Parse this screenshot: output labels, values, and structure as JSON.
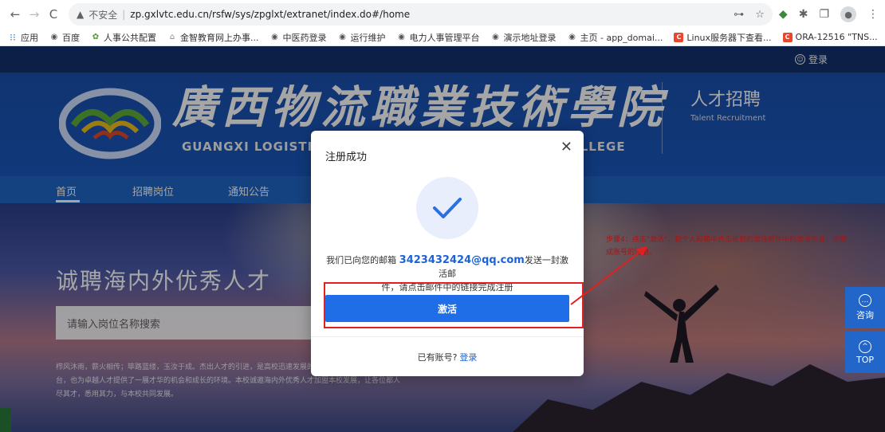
{
  "browser": {
    "insecure_label": "不安全",
    "url": "zp.gxlvtc.edu.cn/rsfw/sys/zpglxt/extranet/index.do#/home",
    "bookmarks": [
      {
        "icon": "apps-icon",
        "label": "应用"
      },
      {
        "icon": "globe-icon",
        "label": "百度"
      },
      {
        "icon": "green-icon",
        "label": "人事公共配置"
      },
      {
        "icon": "house-icon",
        "label": "金智教育网上办事..."
      },
      {
        "icon": "globe-icon",
        "label": "中医药登录"
      },
      {
        "icon": "globe-icon",
        "label": "运行维护"
      },
      {
        "icon": "globe-icon",
        "label": "电力人事管理平台"
      },
      {
        "icon": "globe-icon",
        "label": "演示地址登录"
      },
      {
        "icon": "globe-icon",
        "label": "主页 - app_domai..."
      },
      {
        "icon": "red-c-icon",
        "label": "Linux服务器下查看..."
      },
      {
        "icon": "red-c-icon",
        "label": "ORA-12516 \"TNS..."
      }
    ],
    "bookmarks_more": "»"
  },
  "site": {
    "login_top": "登录",
    "logo_cn": "廣西物流職業技術學院",
    "logo_en": "GUANGXI LOGISTICS VOCATIONAL AND TECHNICAL COLLEGE",
    "talent_cn": "人才招聘",
    "talent_en": "Talent Recruitment",
    "nav": [
      {
        "label": "首页"
      },
      {
        "label": "招聘岗位"
      },
      {
        "label": "通知公告"
      }
    ],
    "banner_title": "诚聘海内外优秀人才",
    "search_placeholder": "请输入岗位名称搜索",
    "intro_lines": [
      "栉风沐雨，薪火相传；筚路蓝缕，玉汝于成。杰出人才的引进，是高校迅速发展的不竭动力，我校为优秀人才提供了广阔的平",
      "台，也为卓越人才提供了一展才华的机会和成长的环境。本校诚邀海内外优秀人才加盟本校发展，让各位都人",
      "尽其才，悉用其力，与本校共同发展。"
    ],
    "red_note": "步骤4：点击\"激活\"，到个人邮箱中点击收到的激活邮件中的激活地址，即完成账号的注册。",
    "side_consult": "咨询",
    "side_top": "TOP"
  },
  "modal": {
    "title": "注册成功",
    "msg_prefix": "我们已向您的邮箱",
    "email": "3423432424@qq.com",
    "msg_suffix": "发送一封激活邮",
    "msg_line2": "件，请点击邮件中的链接完成注册",
    "activate_label": "激活",
    "has_account": "已有账号?",
    "login_link": "登录"
  },
  "colors": {
    "brand_blue": "#1b50ad",
    "button_blue": "#1f6ee8",
    "annotation_red": "#e02020"
  }
}
